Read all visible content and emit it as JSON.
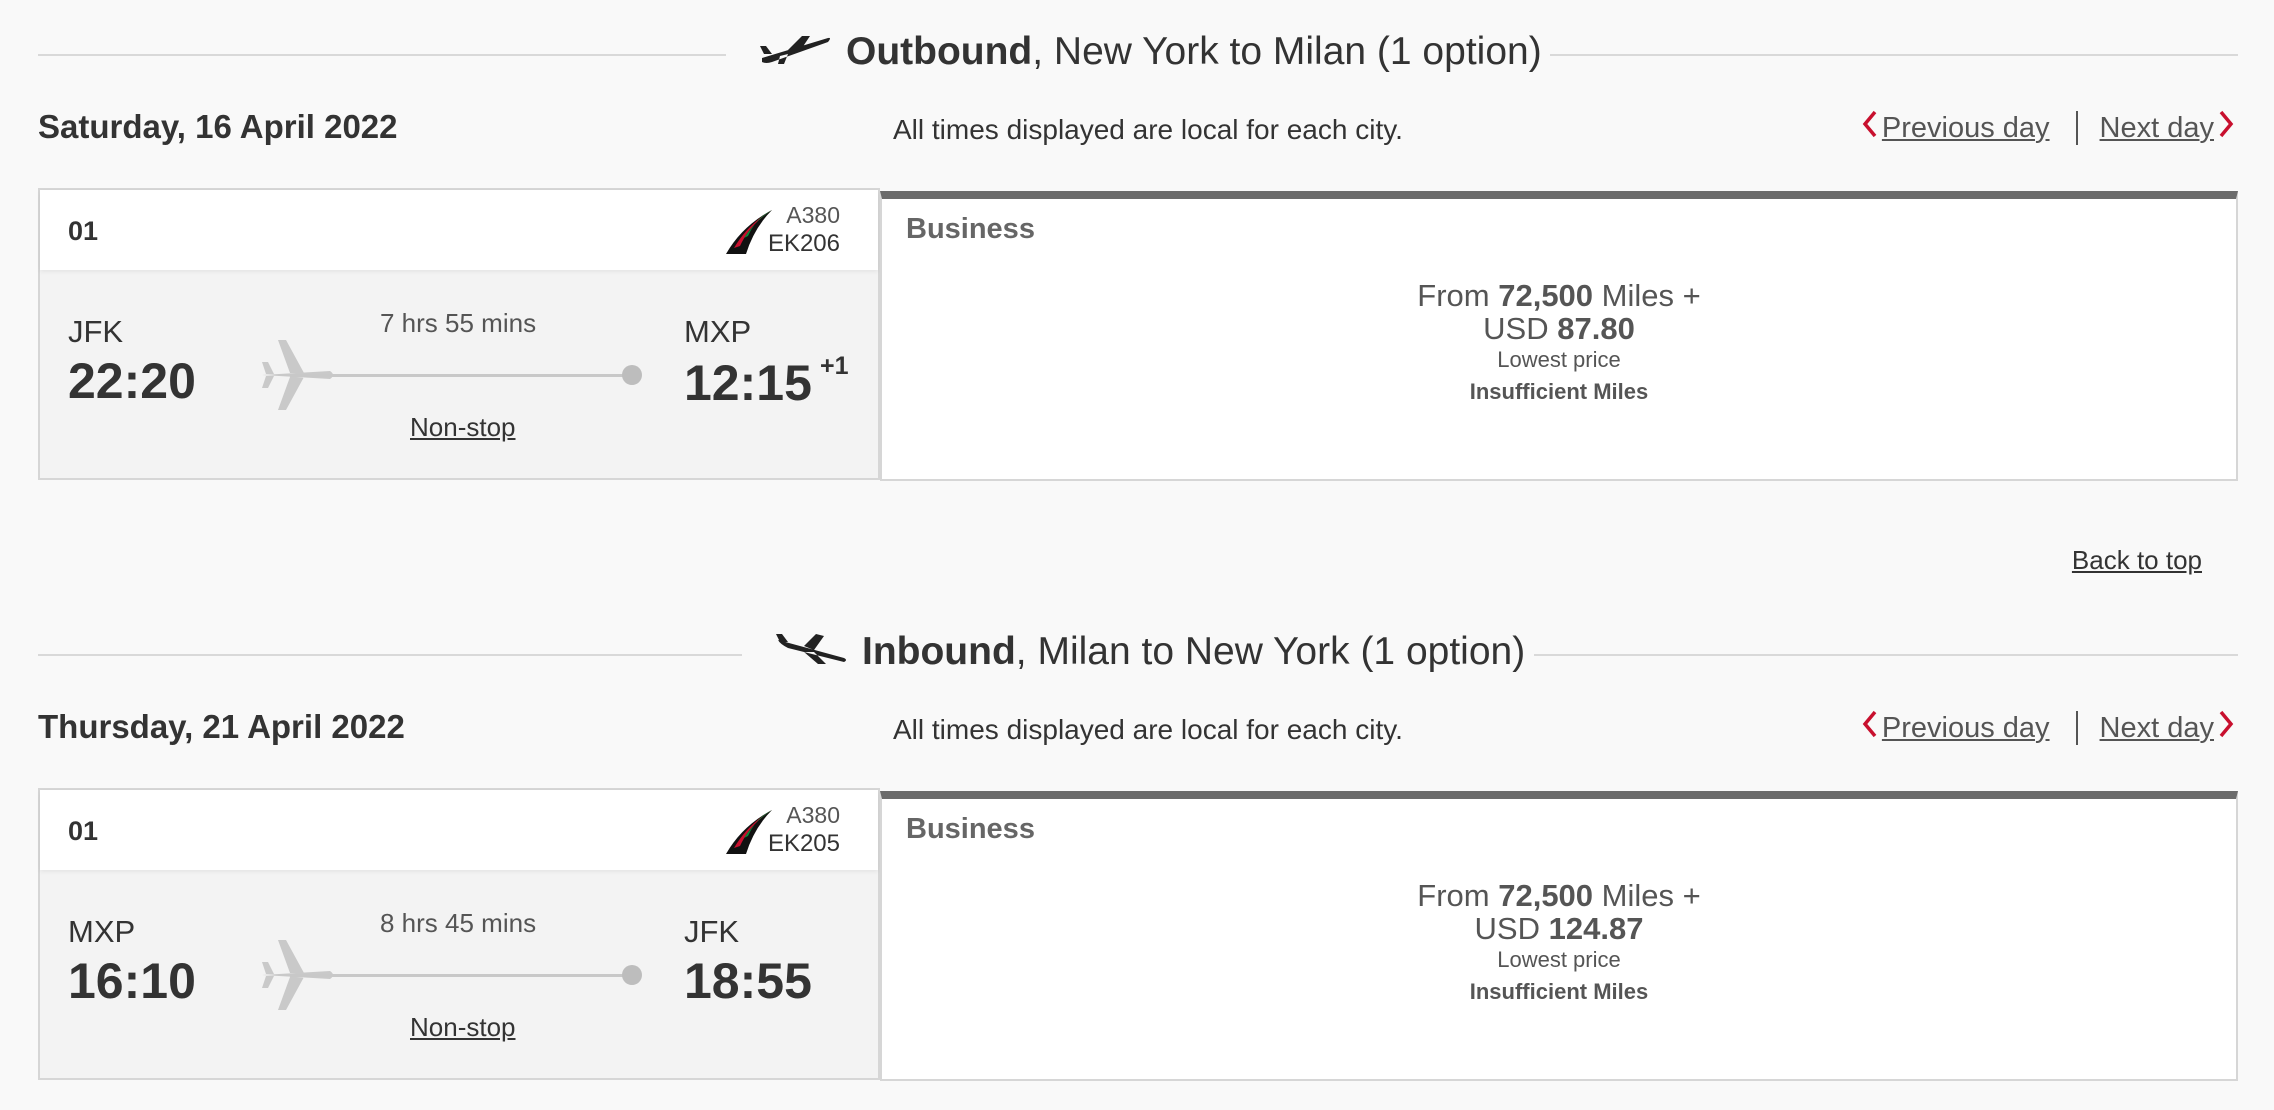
{
  "outbound": {
    "title_bold": "Outbound",
    "title_rest": ", New York to Milan (1 option)",
    "date": "Saturday, 16 April 2022",
    "local_note": "All times displayed are local for each city.",
    "prev_day": "Previous day",
    "next_day": "Next day",
    "option_number": "01",
    "aircraft": "A380",
    "flight_number": "EK206",
    "origin_code": "JFK",
    "departure_time": "22:20",
    "duration": "7 hrs 55 mins",
    "stops": "Non-stop",
    "destination_code": "MXP",
    "arrival_time": "12:15",
    "day_offset": "+1",
    "cabin": "Business",
    "price_from": "From",
    "miles": "72,500",
    "miles_suffix": "Miles +",
    "currency": "USD",
    "amount": "87.80",
    "price_note": "Lowest price",
    "status": "Insufficient Miles"
  },
  "back_to_top": "Back to top",
  "inbound": {
    "title_bold": "Inbound",
    "title_rest": ", Milan to New York (1 option)",
    "date": "Thursday, 21 April 2022",
    "local_note": "All times displayed are local for each city.",
    "prev_day": "Previous day",
    "next_day": "Next day",
    "option_number": "01",
    "aircraft": "A380",
    "flight_number": "EK205",
    "origin_code": "MXP",
    "departure_time": "16:10",
    "duration": "8 hrs 45 mins",
    "stops": "Non-stop",
    "destination_code": "JFK",
    "arrival_time": "18:55",
    "cabin": "Business",
    "price_from": "From",
    "miles": "72,500",
    "miles_suffix": "Miles +",
    "currency": "USD",
    "amount": "124.87",
    "price_note": "Lowest price",
    "status": "Insufficient Miles"
  },
  "colors": {
    "accent_red": "#c8102e",
    "cabin_bar": "#6b6b6b"
  },
  "icons": [
    "departing-plane-icon",
    "arriving-plane-icon",
    "chevron-left-icon",
    "chevron-right-icon",
    "airline-logo",
    "route-plane-icon"
  ]
}
